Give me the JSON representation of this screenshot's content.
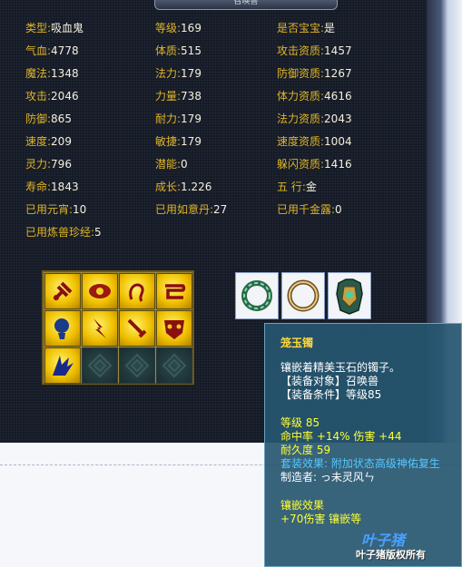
{
  "window": {
    "title": "召唤兽"
  },
  "stats": [
    {
      "k": "类型:",
      "v": "吸血鬼",
      "col": 0,
      "row": 0
    },
    {
      "k": "等级:",
      "v": "169",
      "col": 1,
      "row": 0
    },
    {
      "k": "是否宝宝:",
      "v": "是",
      "col": 2,
      "row": 0
    },
    {
      "k": "气血:",
      "v": "4778",
      "col": 0,
      "row": 1
    },
    {
      "k": "体质:",
      "v": "515",
      "col": 1,
      "row": 1
    },
    {
      "k": "攻击资质:",
      "v": "1457",
      "col": 2,
      "row": 1
    },
    {
      "k": "魔法:",
      "v": "1348",
      "col": 0,
      "row": 2
    },
    {
      "k": "法力:",
      "v": "179",
      "col": 1,
      "row": 2
    },
    {
      "k": "防御资质:",
      "v": "1267",
      "col": 2,
      "row": 2
    },
    {
      "k": "攻击:",
      "v": "2046",
      "col": 0,
      "row": 3
    },
    {
      "k": "力量:",
      "v": "738",
      "col": 1,
      "row": 3
    },
    {
      "k": "体力资质:",
      "v": "4616",
      "col": 2,
      "row": 3
    },
    {
      "k": "防御:",
      "v": "865",
      "col": 0,
      "row": 4
    },
    {
      "k": "耐力:",
      "v": "179",
      "col": 1,
      "row": 4
    },
    {
      "k": "法力资质:",
      "v": "2043",
      "col": 2,
      "row": 4
    },
    {
      "k": "速度:",
      "v": "209",
      "col": 0,
      "row": 5
    },
    {
      "k": "敏捷:",
      "v": "179",
      "col": 1,
      "row": 5
    },
    {
      "k": "速度资质:",
      "v": "1004",
      "col": 2,
      "row": 5
    },
    {
      "k": "灵力:",
      "v": "796",
      "col": 0,
      "row": 6
    },
    {
      "k": "潜能:",
      "v": "0",
      "col": 1,
      "row": 6
    },
    {
      "k": "躲闪资质:",
      "v": "1416",
      "col": 2,
      "row": 6
    },
    {
      "k": "寿命:",
      "v": "1843",
      "col": 0,
      "row": 7
    },
    {
      "k": "成长:",
      "v": "1.226",
      "col": 1,
      "row": 7
    },
    {
      "k": "五    行:",
      "v": "金",
      "col": 2,
      "row": 7
    },
    {
      "k": "已用元宵:",
      "v": "10",
      "col": 0,
      "row": 8
    },
    {
      "k": "已用如意丹:",
      "v": "27",
      "col": 1,
      "row": 8
    },
    {
      "k": "已用千金露:",
      "v": "0",
      "col": 2,
      "row": 8
    },
    {
      "k": "已用炼兽珍经:",
      "v": "5",
      "col": 0,
      "row": 9
    }
  ],
  "skills": [
    {
      "icon": "hammer-icon"
    },
    {
      "icon": "eye-icon"
    },
    {
      "icon": "hook-icon"
    },
    {
      "icon": "scroll-icon"
    },
    {
      "icon": "bulb-icon"
    },
    {
      "icon": "lightning-icon"
    },
    {
      "icon": "sword-icon"
    },
    {
      "icon": "mask-icon"
    },
    {
      "icon": "wing-icon"
    },
    {
      "icon": "empty-slot-icon"
    },
    {
      "icon": "empty-slot-icon"
    },
    {
      "icon": "empty-slot-icon"
    }
  ],
  "equipment": [
    {
      "icon": "jade-bracelet-icon"
    },
    {
      "icon": "gold-ring-icon"
    },
    {
      "icon": "armor-icon"
    }
  ],
  "tooltip": {
    "name": "笼玉镯",
    "desc": "镶嵌着精美玉石的镯子。",
    "target": "【装备对象】召唤兽",
    "cond": "【装备条件】等级85",
    "level": "等级 85",
    "stat1": "命中率 +14% 伤害 +44",
    "durability": "耐久度 59",
    "set_effect": "套装效果: 附加状态高级神佑复生",
    "maker": "制造者: っ未灵风ㄣ",
    "inlay_title": "镶嵌效果",
    "inlay": "+70伤害 镶嵌等"
  },
  "watermark": "叶子猪版权所有",
  "logo_text": "叶子猪"
}
